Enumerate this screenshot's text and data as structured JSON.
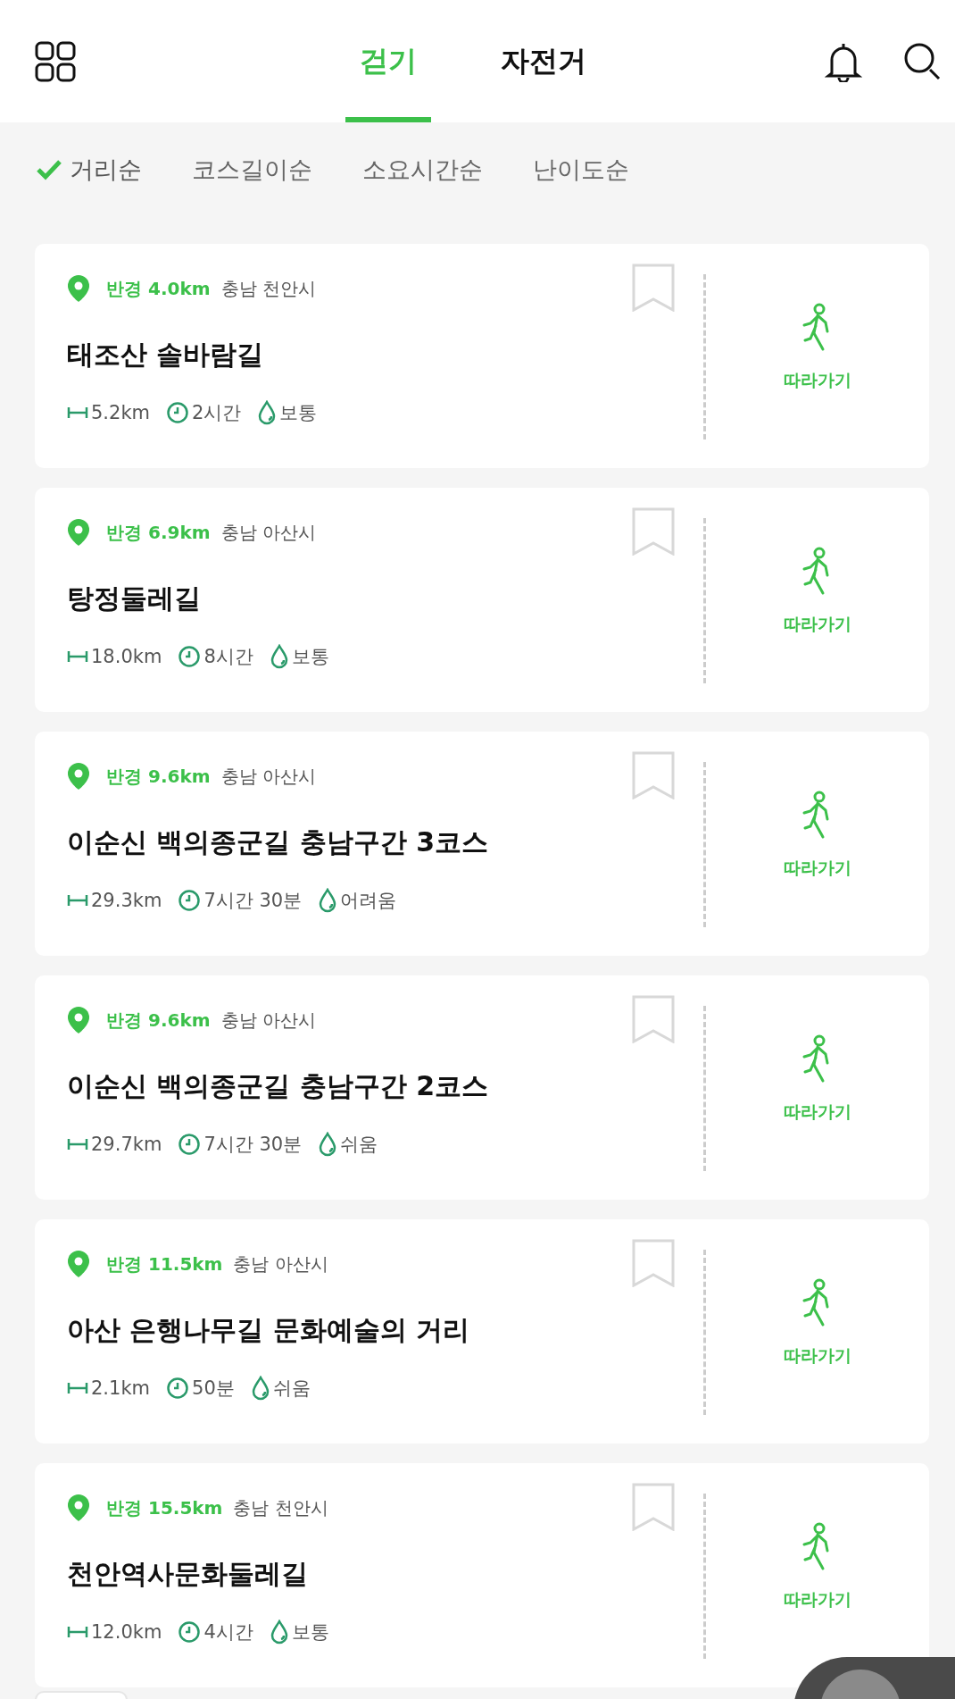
{
  "header": {
    "tabs": [
      {
        "label": "걷기",
        "selected": true
      },
      {
        "label": "자전거",
        "selected": false
      }
    ]
  },
  "sort_options": [
    {
      "label": "거리순",
      "selected": true
    },
    {
      "label": "코스길이순",
      "selected": false
    },
    {
      "label": "소요시간순",
      "selected": false
    },
    {
      "label": "난이도순",
      "selected": false
    }
  ],
  "courses": [
    {
      "radius": "반경 4.0km",
      "region": "충남 천안시",
      "title": "태조산 솔바람길",
      "length": "5.2km",
      "duration": "2시간",
      "difficulty": "보통",
      "bookmarked": false,
      "follow_label": "따라가기"
    },
    {
      "radius": "반경 6.9km",
      "region": "충남 아산시",
      "title": "탕정둘레길",
      "length": "18.0km",
      "duration": "8시간",
      "difficulty": "보통",
      "bookmarked": false,
      "follow_label": "따라가기"
    },
    {
      "radius": "반경 9.6km",
      "region": "충남 아산시",
      "title": "이순신 백의종군길 충남구간 3코스",
      "length": "29.3km",
      "duration": "7시간 30분",
      "difficulty": "어려움",
      "bookmarked": false,
      "follow_label": "따라가기"
    },
    {
      "radius": "반경 9.6km",
      "region": "충남 아산시",
      "title": "이순신 백의종군길 충남구간 2코스",
      "length": "29.7km",
      "duration": "7시간 30분",
      "difficulty": "쉬움",
      "bookmarked": false,
      "follow_label": "따라가기"
    },
    {
      "radius": "반경 11.5km",
      "region": "충남 아산시",
      "title": "아산 은행나무길 문화예술의 거리",
      "length": "2.1km",
      "duration": "50분",
      "difficulty": "쉬움",
      "bookmarked": false,
      "follow_label": "따라가기"
    },
    {
      "radius": "반경 15.5km",
      "region": "충남 천안시",
      "title": "천안역사문화둘레길",
      "length": "12.0km",
      "duration": "4시간",
      "difficulty": "보통",
      "bookmarked": false,
      "follow_label": "따라가기"
    }
  ]
}
